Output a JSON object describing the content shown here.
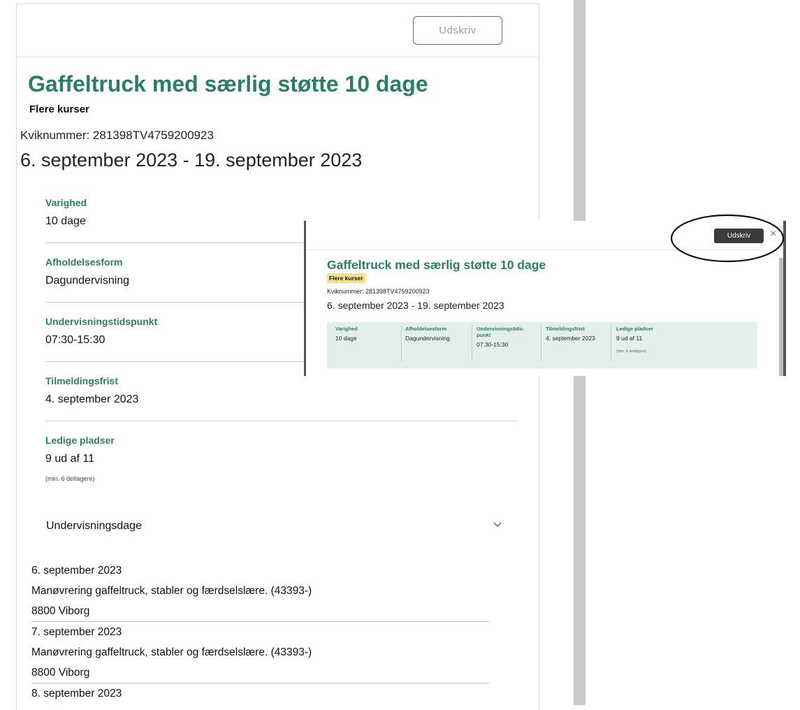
{
  "main": {
    "print_button": "Udskriv",
    "title": "Gaffeltruck med særlig støtte 10 dage",
    "subtitle": "Flere kurser",
    "quick_number": "Kviknummer: 281398TV4759200923",
    "date_range": "6. september 2023 - 19. september 2023",
    "fields": [
      {
        "label": "Varighed",
        "value": "10 dage"
      },
      {
        "label": "Afholdelsesform",
        "value": "Dagundervisning"
      },
      {
        "label": "Undervisningstidspunkt",
        "value": "07:30-15:30"
      },
      {
        "label": "Tilmeldingsfrist",
        "value": "4. september 2023"
      },
      {
        "label": "Ledige pladser",
        "value": "9 ud af 11",
        "note": "(min. 6 deltagere)"
      }
    ],
    "teaching_days": {
      "heading": "Undervisningsdage",
      "days": [
        {
          "date": "6. september 2023",
          "course": "Manøvrering gaffeltruck, stabler og færdselslære. (43393-)",
          "location": "8800 Viborg"
        },
        {
          "date": "7. september 2023",
          "course": "Manøvrering gaffeltruck, stabler og færdselslære. (43393-)",
          "location": "8800 Viborg"
        },
        {
          "date": "8. september 2023"
        }
      ]
    }
  },
  "inset": {
    "print_button": "Udskriv",
    "close_glyph": "×",
    "title": "Gaffeltruck med særlig støtte 10 dage",
    "badge": "Flere kurser",
    "quick_number": "Kviknummer: 281398TV4759200923",
    "date_range": "6. september 2023 - 19. september 2023",
    "columns": [
      {
        "label": "Varighed",
        "value": "10 dage"
      },
      {
        "label": "Afholdelsesform",
        "value": "Dagundervisning"
      },
      {
        "label": "Undervisningstids-",
        "label2": "punkt",
        "value": "07:30-15:30"
      },
      {
        "label": "Tilmeldingsfrist",
        "value": "4. september 2023"
      },
      {
        "label": "Ledige pladser",
        "value": "9 ud af 11",
        "note": "(min. 6 deltagere)"
      }
    ]
  },
  "colors": {
    "accent_green": "#2c7d64",
    "badge_yellow": "#f4e08d",
    "strip_bg": "#e4efea"
  },
  "icons": {
    "chevron": "chevron-down-icon",
    "close": "close-icon"
  }
}
